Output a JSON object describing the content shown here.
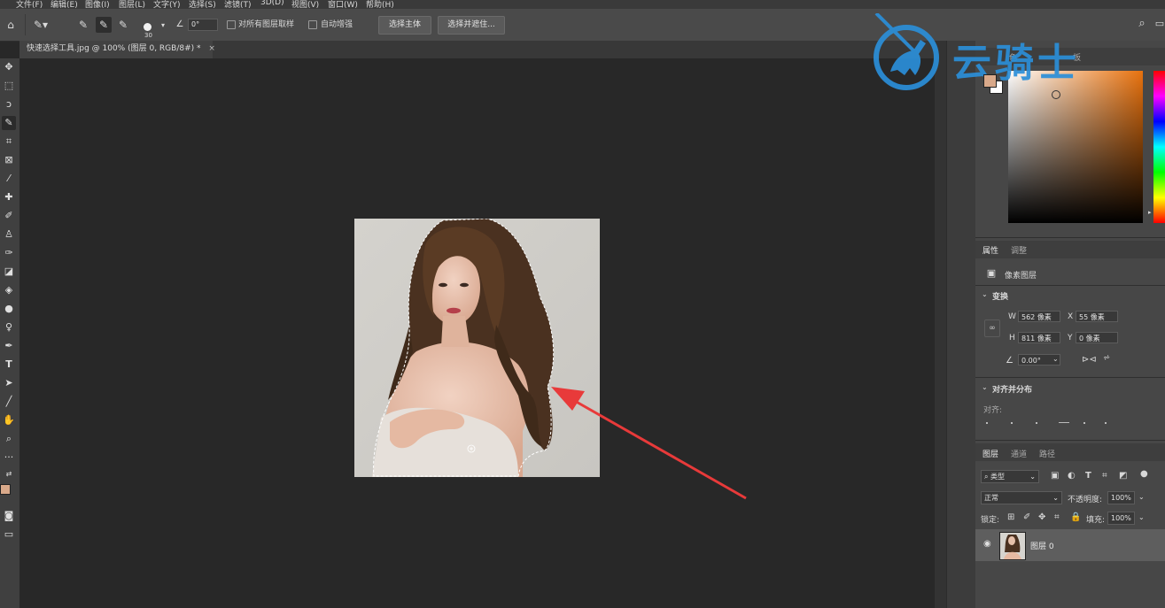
{
  "menu": [
    "文件(F)",
    "编辑(E)",
    "图像(I)",
    "图层(L)",
    "文字(Y)",
    "选择(S)",
    "滤镜(T)",
    "3D(D)",
    "视图(V)",
    "窗口(W)",
    "帮助(H)"
  ],
  "options": {
    "brush_size": "30",
    "angle_value": "0°",
    "sample_all_layers": "对所有图层取样",
    "auto_enhance": "自动增强",
    "select_subject": "选择主体",
    "select_and_mask": "选择并遮住..."
  },
  "document_tab": {
    "title": "快速选择工具.jpg @ 100% (图层 0, RGB/8#) *",
    "close": "×"
  },
  "watermark": {
    "text": "云骑士"
  },
  "color_panel": {
    "tabs": [
      "色",
      "",
      "板"
    ],
    "foreground": "#d9a98a",
    "background": "#ffffff",
    "hue_color": "#e8720e"
  },
  "properties": {
    "tabs": [
      "属性",
      "调整"
    ],
    "layer_kind": "像素图层",
    "transform_header": "变换",
    "w_label": "W",
    "w_value": "562 像素",
    "x_label": "X",
    "x_value": "55 像素",
    "h_label": "H",
    "h_value": "811 像素",
    "y_label": "Y",
    "y_value": "0 像素",
    "angle_value": "0.00°",
    "align_header": "对齐并分布",
    "align_label": "对齐:"
  },
  "layers": {
    "tabs": [
      "图层",
      "通道",
      "路径"
    ],
    "filter_label": "类型",
    "blend_mode": "正常",
    "opacity_label": "不透明度:",
    "opacity_value": "100%",
    "lock_label": "锁定:",
    "fill_label": "填充:",
    "fill_value": "100%",
    "layer_name": "图层 0"
  }
}
